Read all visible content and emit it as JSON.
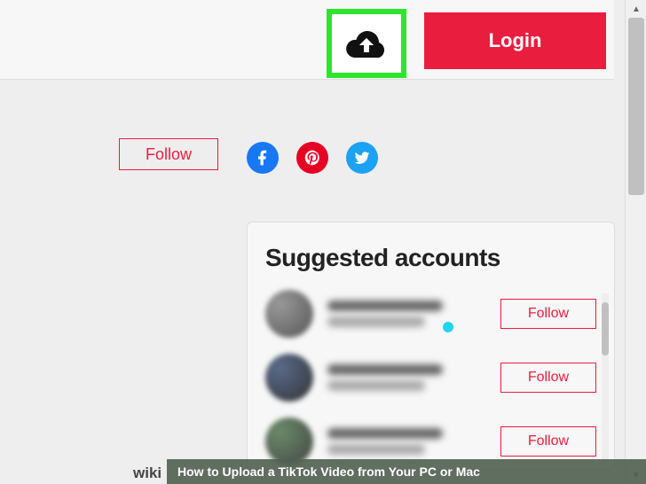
{
  "header": {
    "login_label": "Login"
  },
  "profile": {
    "follow_label": "Follow"
  },
  "social": {
    "facebook": "facebook-icon",
    "pinterest": "pinterest-icon",
    "twitter": "twitter-icon"
  },
  "suggested": {
    "title": "Suggested accounts",
    "accounts": [
      {
        "follow_label": "Follow"
      },
      {
        "follow_label": "Follow"
      },
      {
        "follow_label": "Follow"
      }
    ]
  },
  "caption": {
    "brand": "wiki",
    "text": "How to Upload a TikTok Video from Your PC or Mac"
  }
}
